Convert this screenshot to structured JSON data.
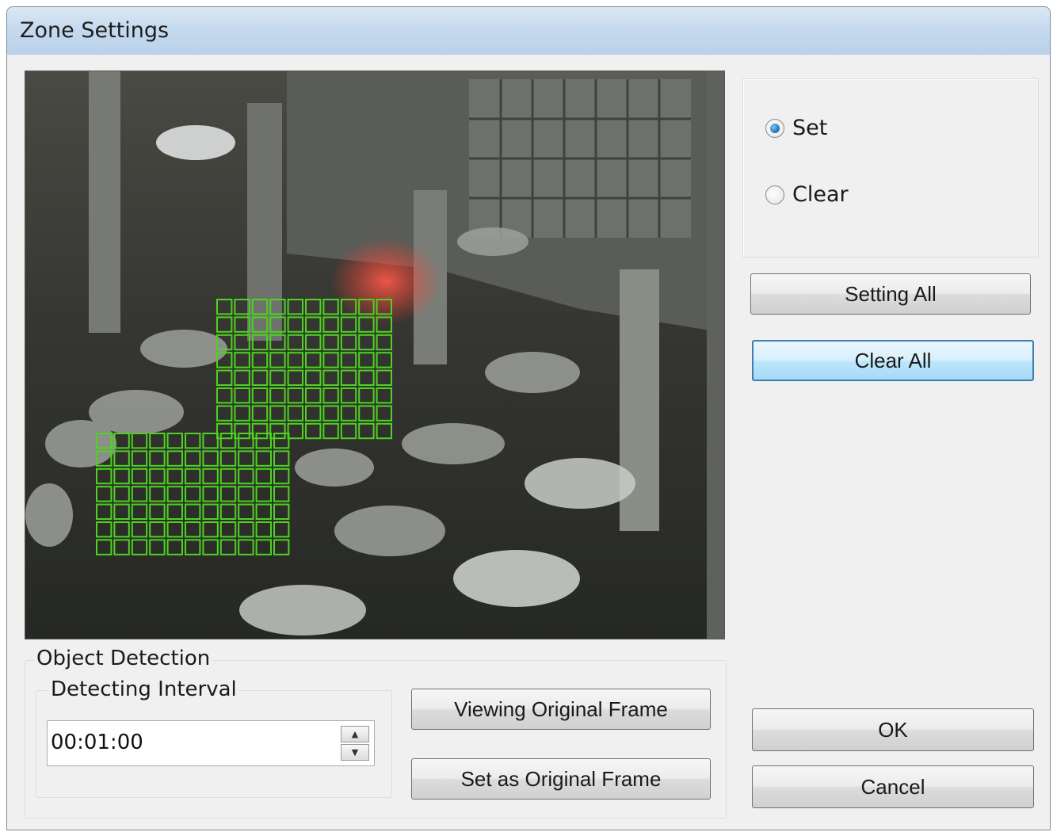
{
  "window": {
    "title": "Zone Settings"
  },
  "camera": {
    "grid_color": "#4ed320"
  },
  "mode": {
    "options": [
      {
        "label": "Set",
        "checked": true
      },
      {
        "label": "Clear",
        "checked": false
      }
    ]
  },
  "buttons": {
    "setting_all": "Setting All",
    "clear_all": "Clear All",
    "viewing_original": "Viewing Original Frame",
    "set_original": "Set as Original Frame",
    "ok": "OK",
    "cancel": "Cancel"
  },
  "object_detection": {
    "label": "Object Detection",
    "interval_label": "Detecting Interval",
    "interval_value": "00:01:00"
  }
}
